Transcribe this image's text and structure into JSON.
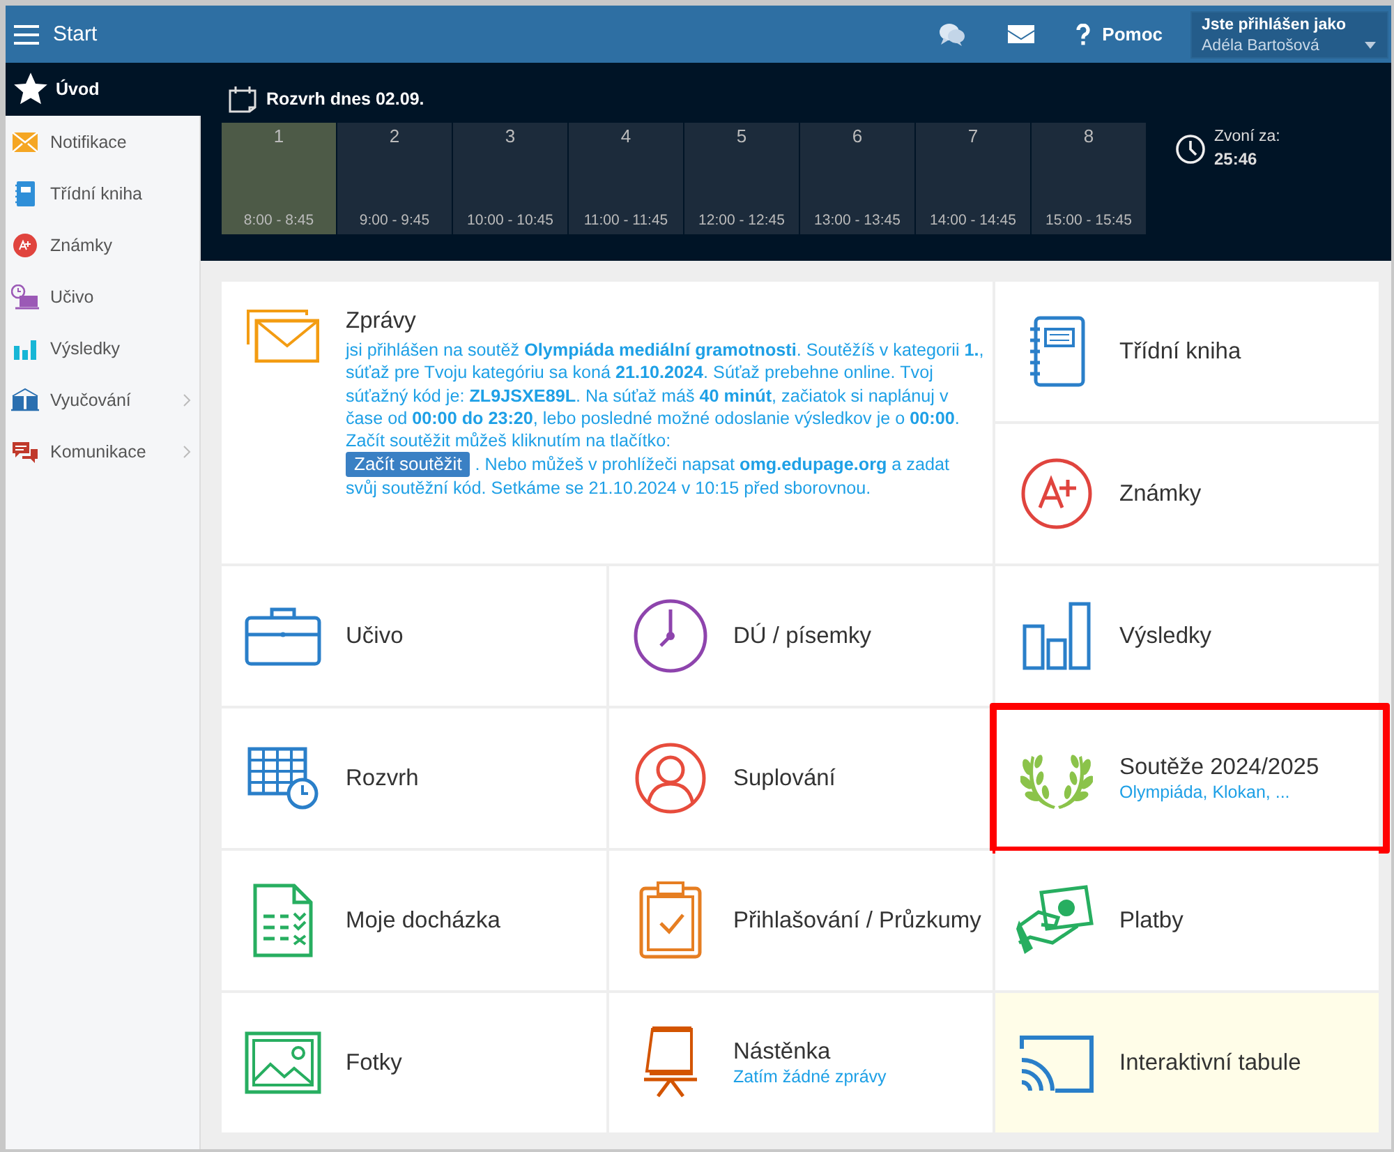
{
  "topbar": {
    "menu_label": "Start",
    "help": "Pomoc",
    "user_caption": "Jste přihlášen jako",
    "user_name": "Adéla Bartošová"
  },
  "sidebar": {
    "items": [
      {
        "label": "Úvod",
        "kind": "star",
        "selected": true,
        "submenu": false
      },
      {
        "label": "Notifikace",
        "kind": "envelope",
        "selected": false,
        "submenu": false
      },
      {
        "label": "Třídní kniha",
        "kind": "book",
        "selected": false,
        "submenu": false
      },
      {
        "label": "Známky",
        "kind": "grade",
        "selected": false,
        "submenu": false
      },
      {
        "label": "Učivo",
        "kind": "board",
        "selected": false,
        "submenu": false
      },
      {
        "label": "Výsledky",
        "kind": "bars",
        "selected": false,
        "submenu": false
      },
      {
        "label": "Vyučování",
        "kind": "openbook",
        "selected": false,
        "submenu": true
      },
      {
        "label": "Komunikace",
        "kind": "chat",
        "selected": false,
        "submenu": true
      }
    ]
  },
  "schedule": {
    "title": "Rozvrh dnes 02.09.",
    "bell_label": "Zvoní za:",
    "bell_time": "25:46",
    "lessons": [
      {
        "number": "1",
        "time": "8:00 - 8:45",
        "current": true
      },
      {
        "number": "2",
        "time": "9:00 - 9:45",
        "current": false
      },
      {
        "number": "3",
        "time": "10:00 - 10:45",
        "current": false
      },
      {
        "number": "4",
        "time": "11:00 - 11:45",
        "current": false
      },
      {
        "number": "5",
        "time": "12:00 - 12:45",
        "current": false
      },
      {
        "number": "6",
        "time": "13:00 - 13:45",
        "current": false
      },
      {
        "number": "7",
        "time": "14:00 - 14:45",
        "current": false
      },
      {
        "number": "8",
        "time": "15:00 - 15:45",
        "current": false
      }
    ]
  },
  "tiles": [
    {
      "kind": "message",
      "title": "Zprávy",
      "text_before": "jsi přihlášen na soutěž **Olympiáda mediální gramotnosti**. Soutěžíš v kategorii **1.**, súťaž pre Tvoju kategóriu sa koná **21.10.2024**. Súťaž prebehne online. Tvoj súťažný kód je: **ZL9JSXE89L**. Na súťaž máš **40 minút**, začiatok si naplánuj v čase od **00:00 do 23:20**, lebo posledné možné odoslanie výsledkov je o **00:00**. Začít soutěžit můžeš kliknutím na tlačítko:",
      "button": "Začít soutěžit",
      "text_after": ". Nebo můžeš v prohlížeči napsat **omg.edupage.org** a zadat svůj soutěžní kód. Setkáme se 21.10.2024 v 10:15 před sborovnou.",
      "highlighted": false,
      "annotated": false
    },
    {
      "kind": "classbook",
      "title": "Třídní kniha",
      "highlighted": false,
      "annotated": false
    },
    {
      "kind": "grade",
      "title": "Známky",
      "highlighted": false,
      "annotated": false
    },
    {
      "kind": "briefcase",
      "title": "Učivo",
      "highlighted": false,
      "annotated": false
    },
    {
      "kind": "clock",
      "title": "DÚ / písemky",
      "highlighted": false,
      "annotated": false
    },
    {
      "kind": "bars",
      "title": "Výsledky",
      "highlighted": false,
      "annotated": false
    },
    {
      "kind": "timetable",
      "title": "Rozvrh",
      "highlighted": false,
      "annotated": false
    },
    {
      "kind": "person",
      "title": "Suplování",
      "highlighted": false,
      "annotated": false
    },
    {
      "kind": "laurel",
      "title": "Soutěže 2024/2025",
      "subtitle": "Olympiáda, Klokan, ...",
      "highlighted": false,
      "annotated": true
    },
    {
      "kind": "attendance",
      "title": "Moje docházka",
      "highlighted": false,
      "annotated": false
    },
    {
      "kind": "clipboard",
      "title": "Přihlašování / Průzkumy",
      "highlighted": false,
      "annotated": false
    },
    {
      "kind": "money",
      "title": "Platby",
      "highlighted": false,
      "annotated": false
    },
    {
      "kind": "photo",
      "title": "Fotky",
      "highlighted": false,
      "annotated": false
    },
    {
      "kind": "flipchart",
      "title": "Nástěnka",
      "subtitle": "Zatím žádné zprávy",
      "highlighted": false,
      "annotated": false
    },
    {
      "kind": "cast",
      "title": "Interaktivní tabule",
      "highlighted": true,
      "annotated": false
    }
  ]
}
